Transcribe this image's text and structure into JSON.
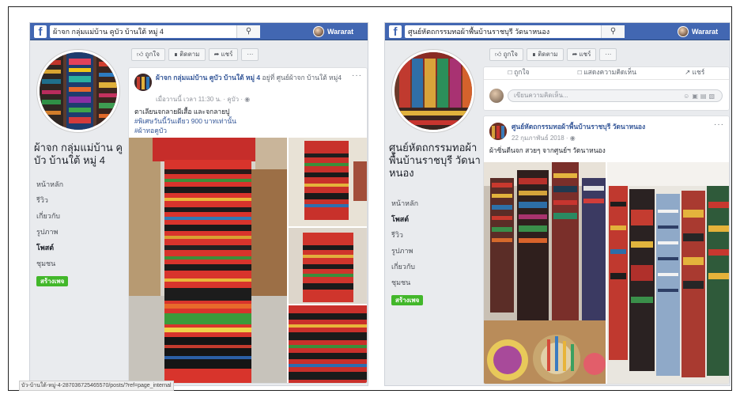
{
  "left": {
    "search_text": "ผ้าจก กลุ่มแม่บ้าน คูบัว บ้านใต้ หมู่ 4",
    "search_icon": "magnifier-icon",
    "user_name": "Wararat",
    "page_name": "ผ้าจก กลุ่มแม่บ้าน คูบัว บ้านใต้ หมู่ 4",
    "nav": [
      "หน้าหลัก",
      "รีวิว",
      "เกี่ยวกับ",
      "รูปภาพ",
      "โพสต์",
      "ชุมชน"
    ],
    "nav_active": "โพสต์",
    "create_btn": "สร้างเพจ",
    "actions": [
      "ถูกใจ",
      "ติดตาม",
      "แชร์",
      "···"
    ],
    "post": {
      "author": "ผ้าจก กลุ่มแม่บ้าน คูบัว บ้านใต้ หมู่ 4",
      "location_text": "อยู่ที่ ศูนย์ผ้าจก บ้านใต้ หมู่4",
      "time": "เมื่อวานนี้ เวลา 11:30 น. · คูบัว · ",
      "line1": "ตาเลียนจกลายผีเสื้อ และจกลายปู",
      "line2": "#พิเศษวันนี้วันเดียว 900 บาทเท่านั้น",
      "line3": "#ผ้าทอคูบัว"
    },
    "status_url": "บัว-บ้านใต้-หมู่-4-287036725465570/posts/?ref=page_internal"
  },
  "right": {
    "search_text": "ศูนย์หัตถกรรมทอผ้าพื้นบ้านราชบุรี วัดนาหนอง",
    "search_icon": "magnifier-icon",
    "user_name": "Wararat",
    "page_name": "ศูนย์หัตถกรรมทอผ้าพื้นบ้านราชบุรี วัดนาหนอง",
    "nav": [
      "หน้าหลัก",
      "โพสต์",
      "รีวิว",
      "รูปภาพ",
      "เกี่ยวกับ",
      "ชุมชน"
    ],
    "nav_active": "โพสต์",
    "create_btn": "สร้างเพจ",
    "actions": [
      "ถูกใจ",
      "ติดตาม",
      "แชร์",
      "···"
    ],
    "share_row": [
      "ถูกใจ",
      "แสดงความคิดเห็น",
      "แชร์"
    ],
    "comment_placeholder": "เขียนความคิดเห็น...",
    "post": {
      "author": "ศูนย์หัตถกรรมทอผ้าพื้นบ้านราชบุรี วัดนาหนอง",
      "time": "22 กุมภาพันธ์ 2018 · ",
      "text": "ผ้าซิ่นตีนจก สวยๆ จากศูนย์ฯ วัดนาหนอง"
    }
  },
  "colors": {
    "fb_blue": "#4267b2",
    "link": "#365899",
    "green": "#42b72a"
  }
}
